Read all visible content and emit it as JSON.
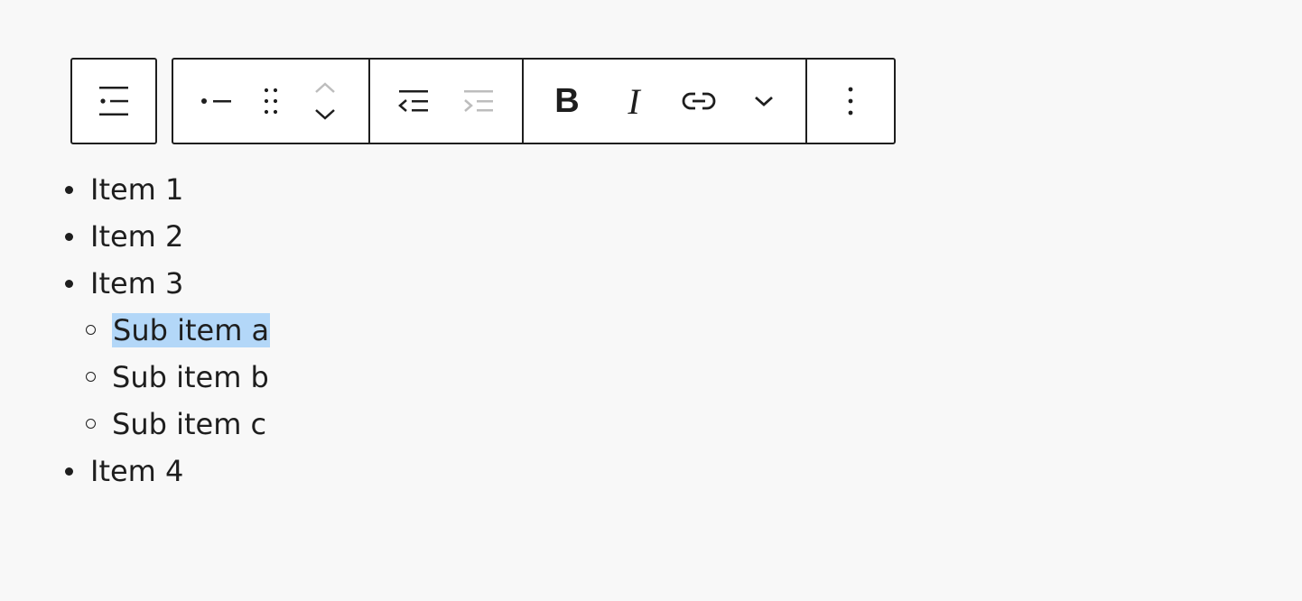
{
  "toolbar": {
    "parent_icon": "list-block-icon",
    "group1": {
      "list_style_icon": "bullet-list-icon",
      "drag_icon": "drag-handle-icon",
      "move_up_icon": "chevron-up-icon",
      "move_down_icon": "chevron-down-icon"
    },
    "group2": {
      "outdent_icon": "outdent-icon",
      "indent_icon": "indent-icon"
    },
    "group3": {
      "bold_label": "B",
      "italic_label": "I",
      "link_icon": "link-icon",
      "more_icon": "chevron-down-icon"
    },
    "group4": {
      "options_icon": "more-vertical-icon"
    }
  },
  "list": {
    "items": [
      {
        "label": "Item 1"
      },
      {
        "label": "Item 2"
      },
      {
        "label": "Item 3",
        "children": [
          {
            "label": "Sub item a",
            "selected": true
          },
          {
            "label": "Sub item b"
          },
          {
            "label": "Sub item c"
          }
        ]
      },
      {
        "label": "Item 4"
      }
    ]
  },
  "colors": {
    "background": "#f8f8f8",
    "text": "#1e1e1e",
    "disabled": "#bdbdbd",
    "selection": "#b3d7f8"
  }
}
